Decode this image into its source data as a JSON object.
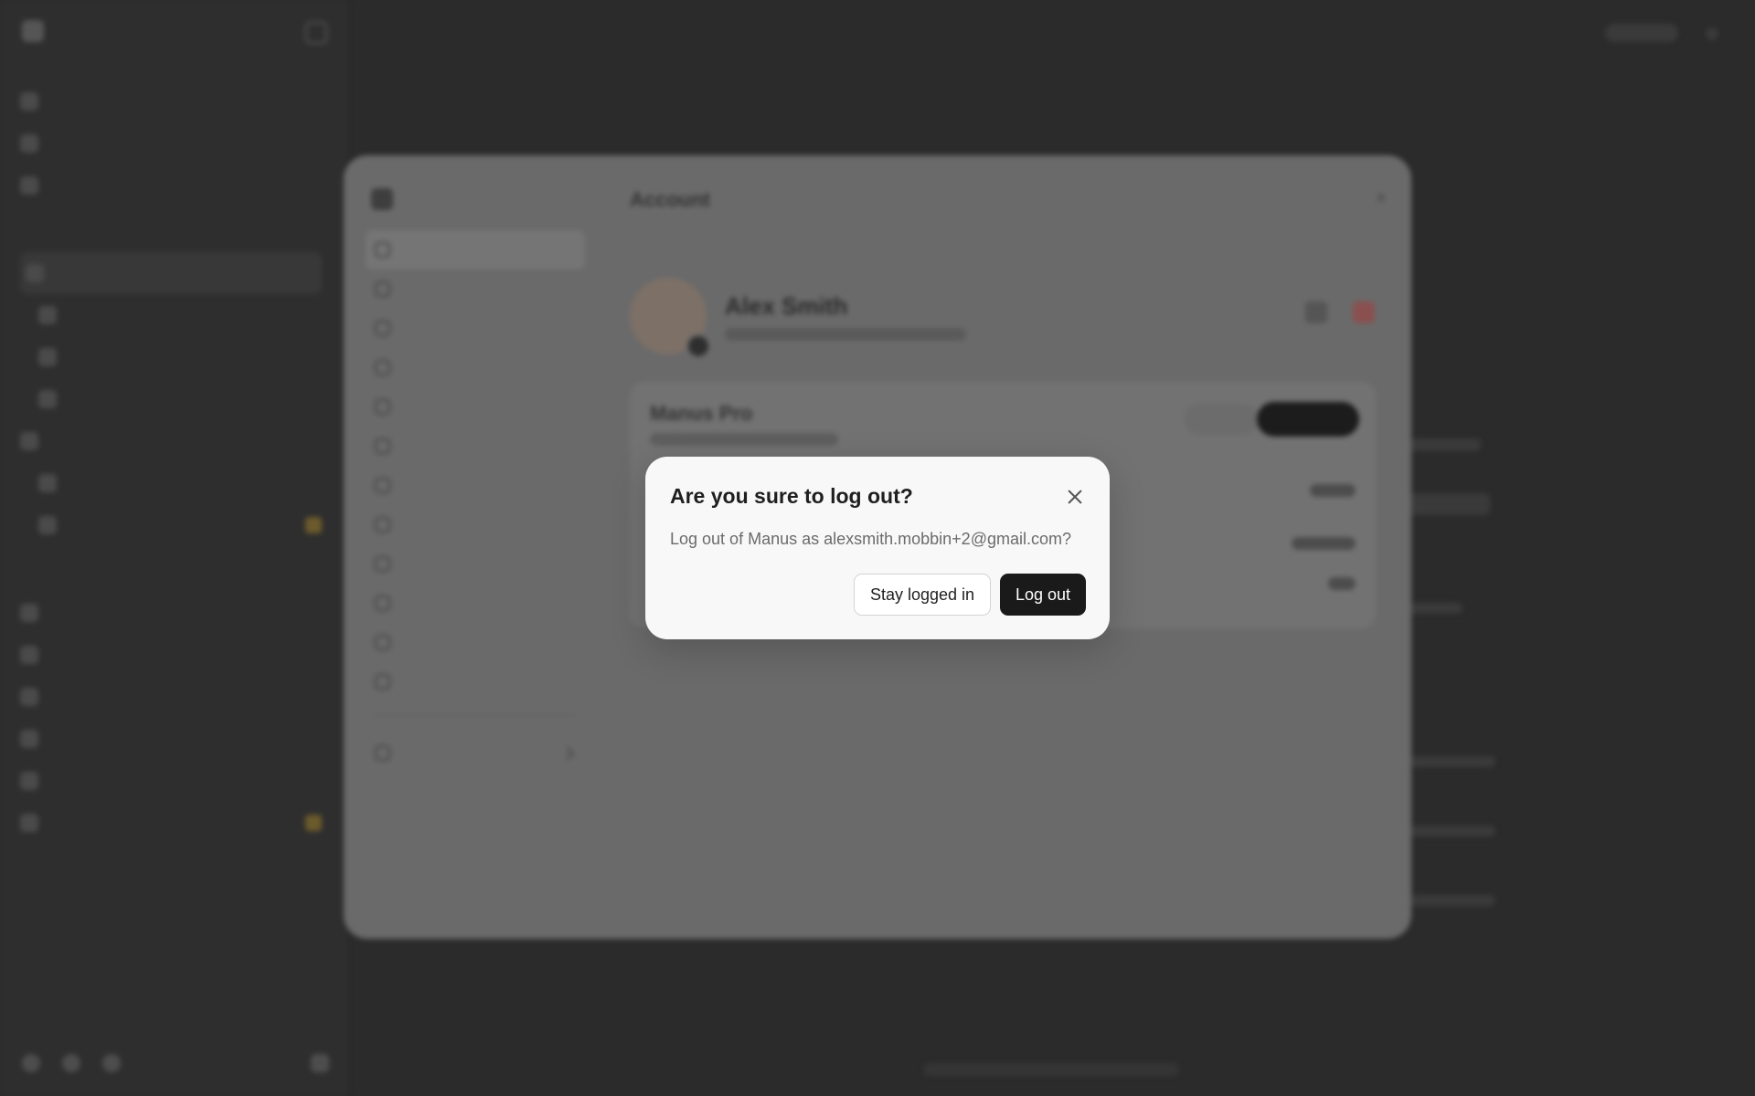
{
  "dialog": {
    "title": "Are you sure to log out?",
    "message": "Log out of Manus as alexsmith.mobbin+2@gmail.com?",
    "stay_label": "Stay logged in",
    "logout_label": "Log out"
  },
  "settings": {
    "title": "Account",
    "profile_name": "Alex Smith",
    "plan_name": "Manus Pro"
  }
}
